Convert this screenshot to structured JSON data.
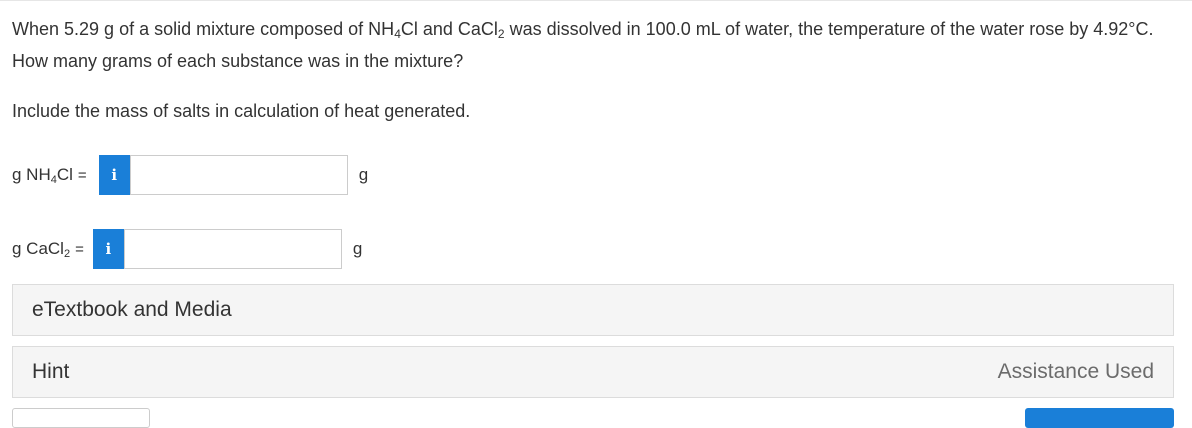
{
  "question": {
    "intro": "When 5.29 g of a solid mixture composed of NH",
    "sub1": "4",
    "mid1": "Cl and CaCl",
    "sub2": "2",
    "rest": " was dissolved in 100.0 mL of water, the temperature of the water rose by 4.92°C. How many grams of each substance was in the mixture?"
  },
  "note": "Include the mass of salts in calculation of heat generated.",
  "answers": [
    {
      "label_pre": "g NH",
      "label_sub": "4",
      "label_post": "Cl",
      "equals": "=",
      "info_icon": "i",
      "value": "",
      "unit": "g"
    },
    {
      "label_pre": "g CaCl",
      "label_sub": "2",
      "label_post": "",
      "equals": "=",
      "info_icon": "i",
      "value": "",
      "unit": "g"
    }
  ],
  "panels": {
    "etextbook": "eTextbook and Media",
    "hint": "Hint",
    "assistance": "Assistance Used"
  },
  "colors": {
    "accent": "#1a7fd8",
    "panel_bg": "#f5f5f5",
    "text": "#333333",
    "muted": "#6b6b6b"
  }
}
